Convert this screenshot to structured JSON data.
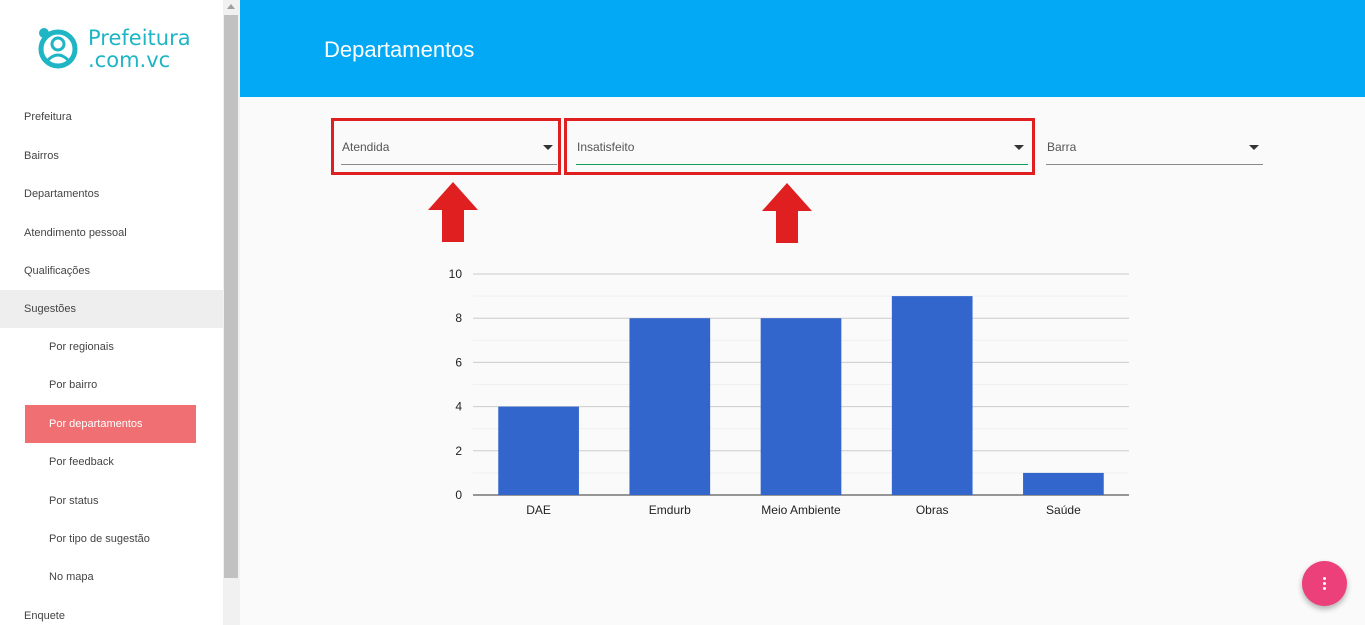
{
  "logo": {
    "line1": "Prefeitura",
    "line2": ".com.vc"
  },
  "sidebar": {
    "items": [
      {
        "label": "Prefeitura"
      },
      {
        "label": "Bairros"
      },
      {
        "label": "Departamentos"
      },
      {
        "label": "Atendimento pessoal"
      },
      {
        "label": "Qualificações"
      },
      {
        "label": "Sugestões"
      },
      {
        "label": "Por regionais"
      },
      {
        "label": "Por bairro"
      },
      {
        "label": "Por departamentos"
      },
      {
        "label": "Por feedback"
      },
      {
        "label": "Por status"
      },
      {
        "label": "Por tipo de sugestão"
      },
      {
        "label": "No mapa"
      },
      {
        "label": "Enquete"
      }
    ]
  },
  "header": {
    "title": "Departamentos"
  },
  "filters": {
    "status": "Atendida",
    "feedback": "Insatisfeito",
    "chart_type": "Barra"
  },
  "colors": {
    "accent": "#03a9f4",
    "bar": "#3366cc",
    "active_item": "#ef6f72",
    "fab": "#ec407a",
    "highlight": "#e02020"
  },
  "chart_data": {
    "type": "bar",
    "categories": [
      "DAE",
      "Emdurb",
      "Meio Ambiente",
      "Obras",
      "Saúde"
    ],
    "values": [
      4,
      8,
      8,
      9,
      1
    ],
    "ylim": [
      0,
      10
    ],
    "yticks": [
      0,
      2,
      4,
      6,
      8,
      10
    ],
    "grid": true,
    "title": "",
    "xlabel": "",
    "ylabel": ""
  }
}
